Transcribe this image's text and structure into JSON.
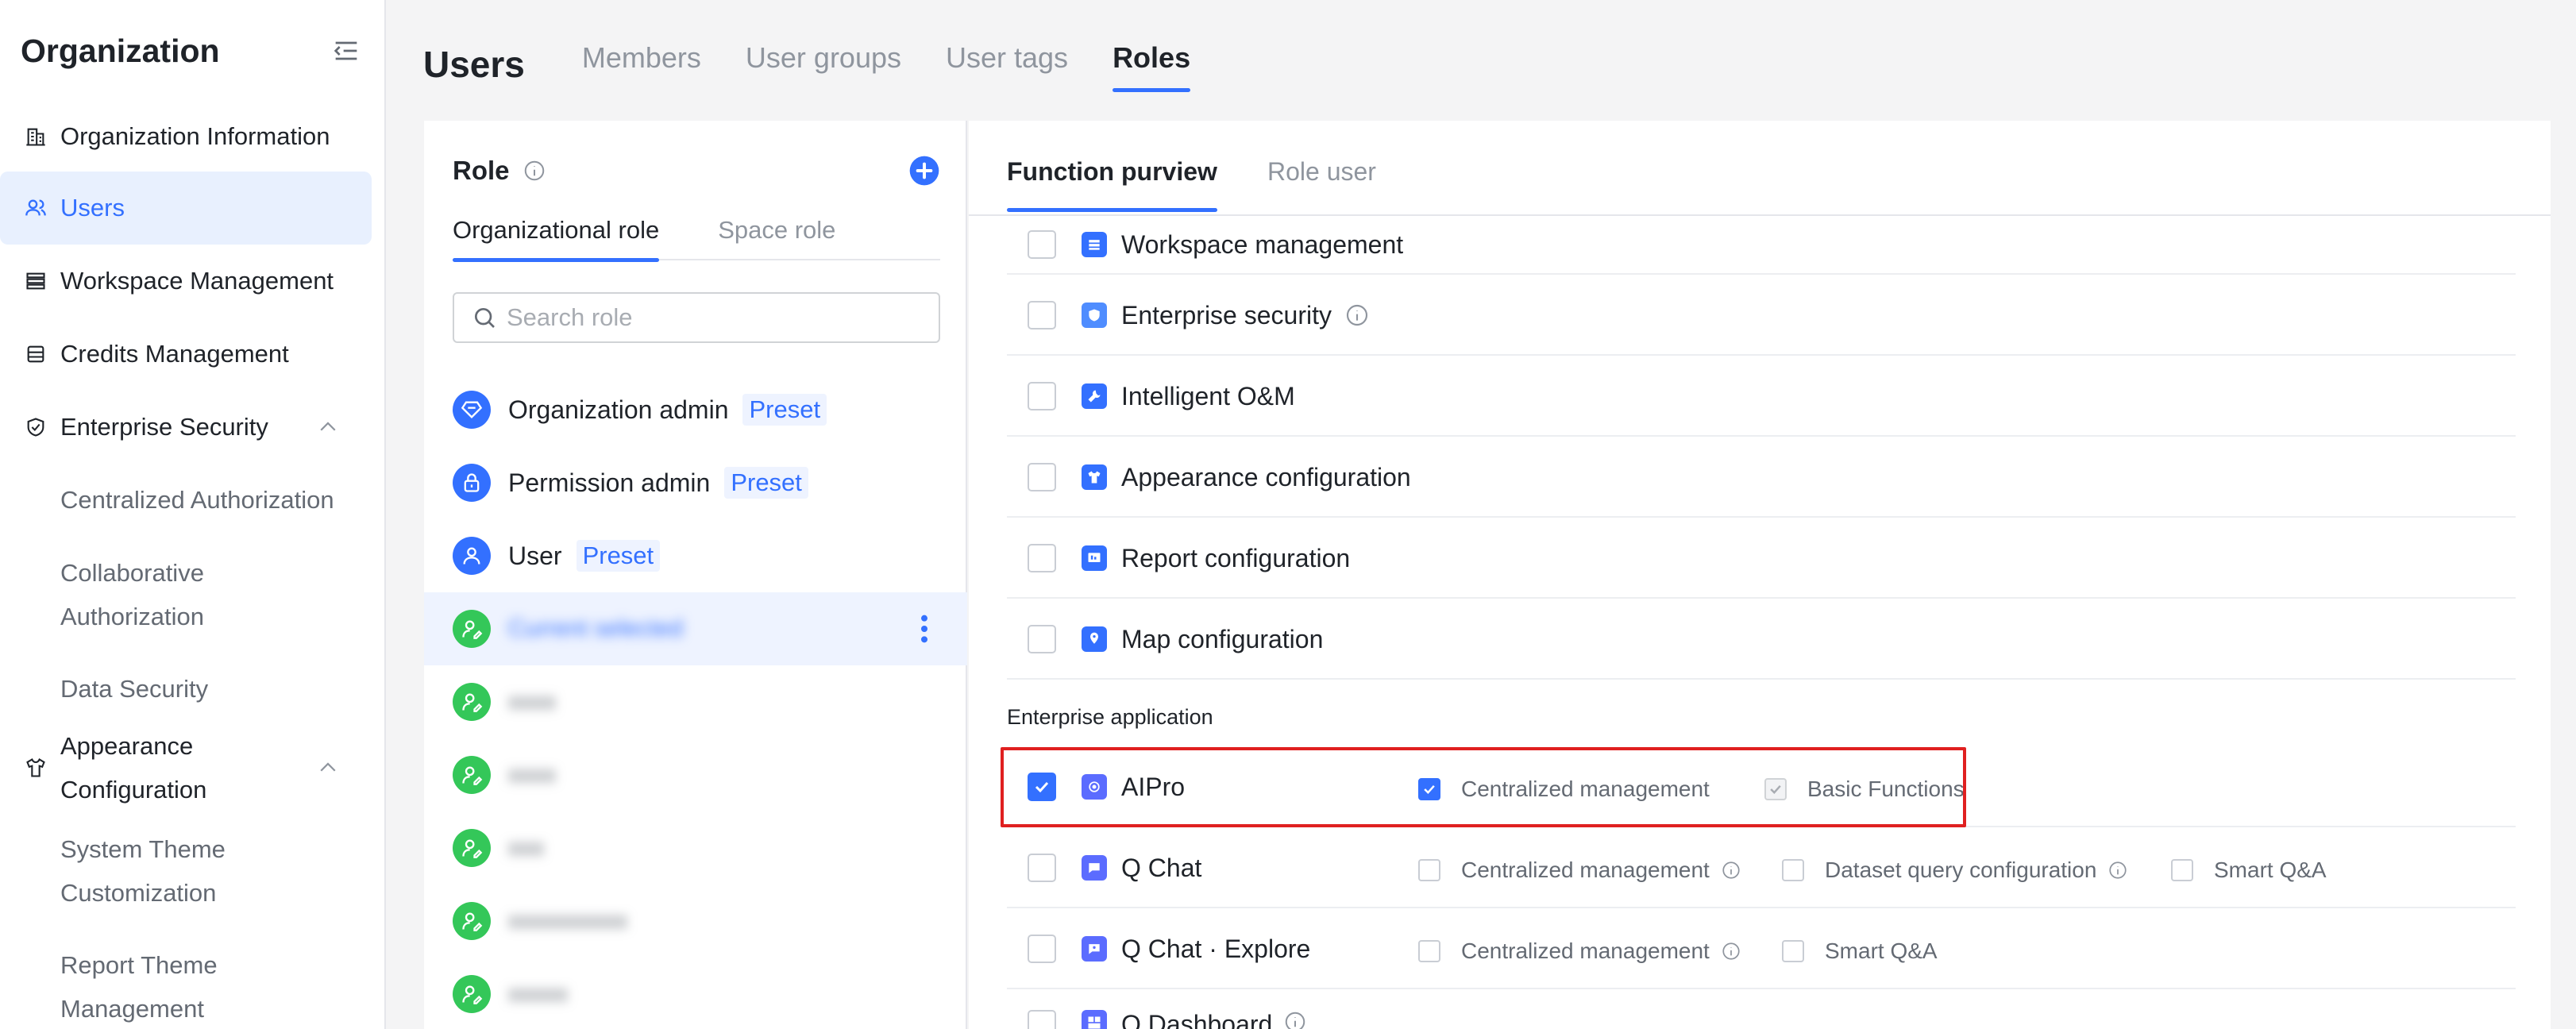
{
  "sidebar": {
    "title": "Organization",
    "items": [
      {
        "label": "Organization Information",
        "icon": "building-icon"
      },
      {
        "label": "Users",
        "icon": "users-icon",
        "active": true
      },
      {
        "label": "Workspace Management",
        "icon": "stack-icon"
      },
      {
        "label": "Credits Management",
        "icon": "database-icon"
      },
      {
        "label": "Enterprise Security",
        "icon": "shield-icon",
        "expanded": true
      },
      {
        "label": "Appearance Configuration",
        "icon": "shirt-icon",
        "expanded": true
      }
    ],
    "security_sub": [
      "Centralized Authorization",
      "Collaborative Authorization",
      "Data Security"
    ],
    "appearance_sub": [
      "System Theme Customization",
      "Report Theme Management"
    ]
  },
  "header": {
    "title": "Users",
    "tabs": [
      "Members",
      "User groups",
      "User tags",
      "Roles"
    ],
    "active_tab": "Roles"
  },
  "role_panel": {
    "title": "Role",
    "tabs": [
      "Organizational role",
      "Space role"
    ],
    "search_placeholder": "Search role",
    "preset_label": "Preset",
    "roles": [
      {
        "name": "Organization admin",
        "preset": "Preset",
        "icon": "diamond-icon"
      },
      {
        "name": "Permission admin",
        "preset": "Preset",
        "icon": "lock-icon"
      },
      {
        "name": "User",
        "preset": "Preset",
        "icon": "person-icon"
      }
    ],
    "blurred_roles": [
      "Current selected",
      "xxxx",
      "xxxx",
      "xxx",
      "xxxxxxxxxx",
      "xxxxx"
    ]
  },
  "function_panel": {
    "tabs": [
      "Function purview",
      "Role user"
    ],
    "rows": [
      {
        "label": "Workspace management",
        "icon": "workspace-icon"
      },
      {
        "label": "Enterprise security",
        "icon": "security-shield-icon",
        "info": true
      },
      {
        "label": "Intelligent O&M",
        "icon": "wrench-icon"
      },
      {
        "label": "Appearance configuration",
        "icon": "appearance-icon"
      },
      {
        "label": "Report configuration",
        "icon": "report-icon"
      },
      {
        "label": "Map configuration",
        "icon": "map-icon"
      }
    ],
    "section_label": "Enterprise application",
    "apps": [
      {
        "label": "AIPro",
        "checked": true,
        "options": [
          {
            "label": "Centralized management",
            "checked": true
          },
          {
            "label": "Basic Functions",
            "checked": true,
            "disabled": true
          }
        ]
      },
      {
        "label": "Q Chat",
        "checked": false,
        "options": [
          {
            "label": "Centralized management",
            "info": true
          },
          {
            "label": "Dataset query configuration",
            "info": true
          },
          {
            "label": "Smart Q&A"
          }
        ]
      },
      {
        "label": "Q Chat · Explore",
        "checked": false,
        "options": [
          {
            "label": "Centralized management",
            "info": true
          },
          {
            "label": "Smart Q&A"
          }
        ]
      },
      {
        "label": "Q Dashboard",
        "checked": false,
        "info": true
      }
    ]
  },
  "colors": {
    "accent": "#3370ff",
    "highlight": "#e02020",
    "role_green": "#34c759"
  }
}
